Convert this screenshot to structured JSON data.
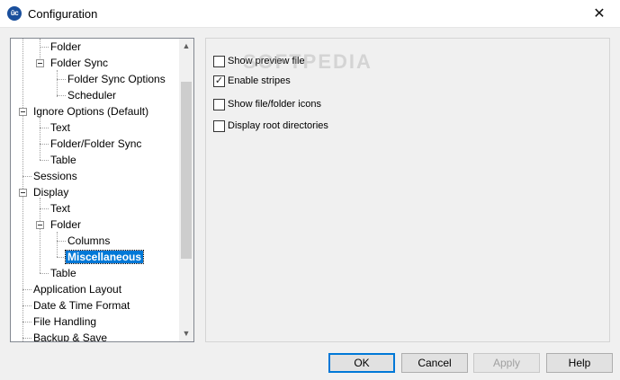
{
  "window": {
    "title": "Configuration",
    "app_icon_text": "ûc",
    "close_glyph": "✕"
  },
  "tree": {
    "items": [
      {
        "label": "Folder",
        "selected": false
      },
      {
        "label": "Folder Sync",
        "selected": false
      },
      {
        "label": "Folder Sync Options",
        "selected": false
      },
      {
        "label": "Scheduler",
        "selected": false
      },
      {
        "label": "Ignore Options (Default)",
        "selected": false
      },
      {
        "label": "Text",
        "selected": false
      },
      {
        "label": "Folder/Folder Sync",
        "selected": false
      },
      {
        "label": "Table",
        "selected": false
      },
      {
        "label": "Sessions",
        "selected": false
      },
      {
        "label": "Display",
        "selected": false
      },
      {
        "label": "Text",
        "selected": false
      },
      {
        "label": "Folder",
        "selected": false
      },
      {
        "label": "Columns",
        "selected": false
      },
      {
        "label": "Miscellaneous",
        "selected": true
      },
      {
        "label": "Table",
        "selected": false
      },
      {
        "label": "Application Layout",
        "selected": false
      },
      {
        "label": "Date & Time Format",
        "selected": false
      },
      {
        "label": "File Handling",
        "selected": false
      },
      {
        "label": "Backup & Save",
        "selected": false
      }
    ],
    "scroll_up_glyph": "▲",
    "scroll_down_glyph": "▼"
  },
  "options": [
    {
      "label": "Show preview file",
      "checked": false
    },
    {
      "label": "Enable stripes",
      "checked": true
    },
    {
      "label": "Show file/folder icons",
      "checked": false
    },
    {
      "label": "Display root directories",
      "checked": false
    }
  ],
  "watermark": "SOFTPEDIA",
  "buttons": {
    "ok": "OK",
    "cancel": "Cancel",
    "apply": "Apply",
    "help": "Help"
  },
  "colors": {
    "selection": "#0078d7",
    "default_button_border": "#0078d7"
  }
}
